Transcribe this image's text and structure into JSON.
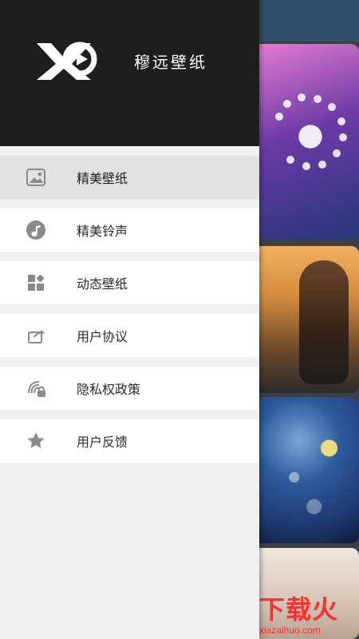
{
  "drawer": {
    "header": {
      "app_name": "穆远壁纸",
      "logo_icon": "xo-play-logo-icon"
    },
    "menu_items": [
      {
        "label": "精美壁纸",
        "icon": "image-icon",
        "active": true
      },
      {
        "label": "精美铃声",
        "icon": "music-note-icon",
        "active": false
      },
      {
        "label": "动态壁纸",
        "icon": "tiles-icon",
        "active": false
      },
      {
        "label": "用户协议",
        "icon": "share-icon",
        "active": false
      },
      {
        "label": "隐私权政策",
        "icon": "privacy-lock-icon",
        "active": false
      },
      {
        "label": "用户反馈",
        "icon": "star-icon",
        "active": false
      }
    ]
  },
  "background": {
    "watermark": {
      "title": "下载火",
      "url": "xiazaihuo.com",
      "icon": "flame-download-icon"
    }
  },
  "colors": {
    "drawer_header": "#1e1e1e",
    "drawer_bg": "#f0f0f0",
    "menu_item_bg": "#ffffff",
    "menu_item_active_bg": "#e2e2e2",
    "watermark_red": "#ff2f2f"
  }
}
